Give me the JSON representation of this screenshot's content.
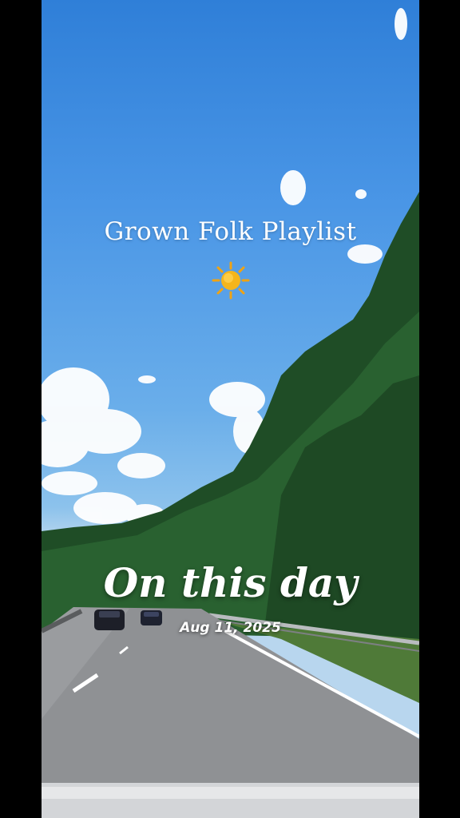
{
  "overlay": {
    "playlist_title": "Grown Folk Playlist",
    "sun_emoji_icon": "sun-icon",
    "memory_title": "On this day",
    "memory_date": "Aug 11, 2025"
  },
  "colors": {
    "sky_top": "#2f7fd8",
    "sky_bottom": "#b8d6ee",
    "trees": "#1f4d26",
    "road": "#8f9194",
    "text": "#ffffff",
    "sun": "#f5b51b"
  }
}
